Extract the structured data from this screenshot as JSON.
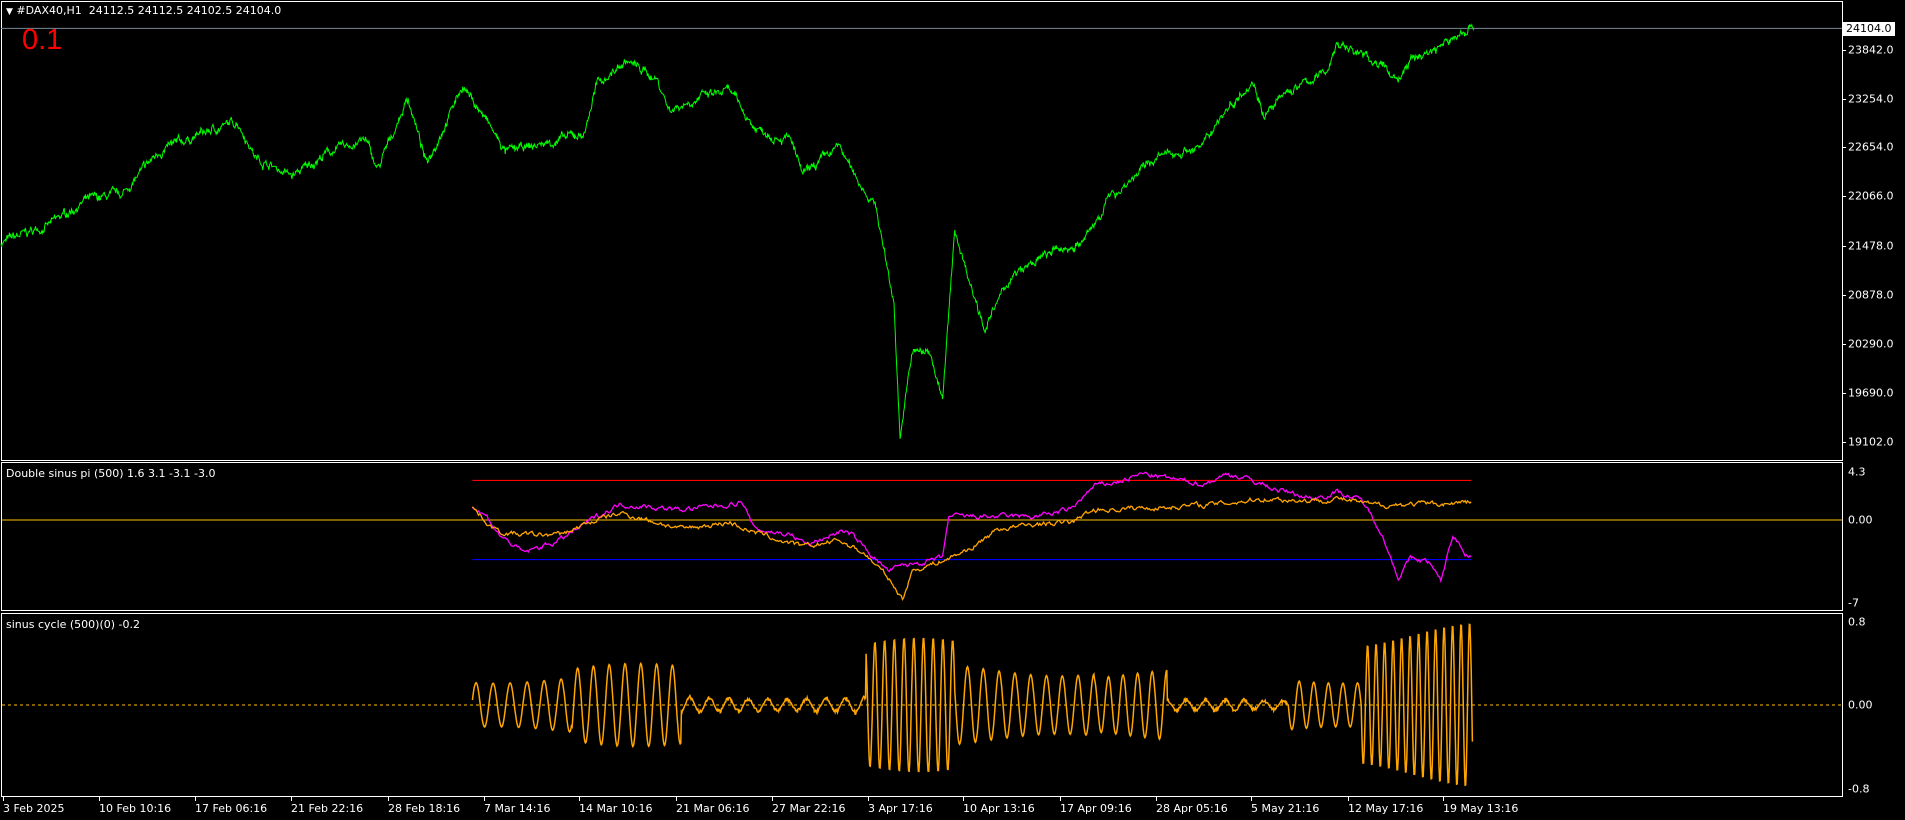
{
  "header": {
    "symbol": "#DAX40,H1",
    "ohlc": "24112.5 24112.5 24102.5 24104.0",
    "overlay_value": "0.1"
  },
  "colors": {
    "price": "#00ff00",
    "magenta": "#ff00ff",
    "orange": "#ffa500",
    "red": "#ff0000",
    "blue": "#0000ff",
    "zero": "#ffc000",
    "bidline": "#778899"
  },
  "price_axis": {
    "current": "24104.0",
    "ticks": [
      "23842.0",
      "23254.0",
      "22654.0",
      "22066.0",
      "21478.0",
      "20878.0",
      "20290.0",
      "19690.0",
      "19102.0"
    ]
  },
  "ind1": {
    "title": "Double sinus pi (500) 1.6 3.1 -3.1 -3.0",
    "ticks": [
      "4.3",
      "0.00",
      "-7"
    ]
  },
  "ind2": {
    "title": "sinus cycle (500)(0) -0.2",
    "ticks": [
      "0.8",
      "0.00",
      "-0.8"
    ]
  },
  "time_axis": [
    "3 Feb 2025",
    "10 Feb 10:16",
    "17 Feb 06:16",
    "21 Feb 22:16",
    "28 Feb 18:16",
    "7 Mar 14:16",
    "14 Mar 10:16",
    "21 Mar 06:16",
    "27 Mar 22:16",
    "3 Apr 17:16",
    "10 Apr 13:16",
    "17 Apr 09:16",
    "28 Apr 05:16",
    "5 May 21:16",
    "12 May 17:16",
    "19 May 13:16"
  ],
  "chart_data": [
    {
      "type": "line",
      "title": "#DAX40,H1",
      "ylim": [
        18950,
        24200
      ],
      "current": 24104.0,
      "series": [
        {
          "name": "price",
          "points": [
            [
              0,
              21510
            ],
            [
              40,
              21730
            ],
            [
              70,
              22023
            ],
            [
              100,
              22096
            ],
            [
              130,
              22610
            ],
            [
              165,
              22830
            ],
            [
              195,
              22976
            ],
            [
              210,
              22536
            ],
            [
              240,
              22316
            ],
            [
              270,
              22610
            ],
            [
              300,
              22756
            ],
            [
              310,
              22390
            ],
            [
              335,
              23270
            ],
            [
              350,
              22463
            ],
            [
              380,
              23417
            ],
            [
              400,
              22976
            ],
            [
              415,
              22610
            ],
            [
              440,
              22683
            ],
            [
              480,
              22830
            ],
            [
              490,
              23417
            ],
            [
              515,
              23710
            ],
            [
              540,
              23490
            ],
            [
              550,
              23123
            ],
            [
              575,
              23270
            ],
            [
              600,
              23343
            ],
            [
              620,
              22903
            ],
            [
              650,
              22756
            ],
            [
              660,
              22316
            ],
            [
              690,
              22683
            ],
            [
              700,
              22390
            ],
            [
              720,
              21950
            ],
            [
              735,
              20776
            ],
            [
              740,
              19162
            ],
            [
              750,
              20189
            ],
            [
              765,
              20189
            ],
            [
              775,
              19603
            ],
            [
              785,
              21656
            ],
            [
              800,
              20923
            ],
            [
              810,
              20483
            ],
            [
              830,
              21070
            ],
            [
              860,
              21363
            ],
            [
              890,
              21510
            ],
            [
              900,
              21730
            ],
            [
              910,
              22023
            ],
            [
              950,
              22536
            ],
            [
              990,
              22683
            ],
            [
              1000,
              22976
            ],
            [
              1030,
              23490
            ],
            [
              1040,
              23050
            ],
            [
              1060,
              23343
            ],
            [
              1090,
              23563
            ],
            [
              1100,
              23930
            ],
            [
              1130,
              23710
            ],
            [
              1150,
              23490
            ],
            [
              1160,
              23710
            ],
            [
              1190,
              23930
            ],
            [
              1212,
              24150
            ]
          ]
        }
      ]
    },
    {
      "type": "line",
      "title": "Double sinus pi (500)",
      "ylim": [
        -7,
        4.3
      ],
      "levels": [
        3.5,
        0,
        -3.5
      ],
      "series": [
        {
          "name": "magenta",
          "points": [
            [
              388,
              1.1
            ],
            [
              400,
              0.3
            ],
            [
              410,
              -1.3
            ],
            [
              430,
              -2.9
            ],
            [
              460,
              -1.8
            ],
            [
              490,
              0.3
            ],
            [
              510,
              1.4
            ],
            [
              540,
              1.1
            ],
            [
              560,
              0.9
            ],
            [
              600,
              1.4
            ],
            [
              610,
              1.6
            ],
            [
              620,
              -0.8
            ],
            [
              650,
              -1.3
            ],
            [
              665,
              -2.2
            ],
            [
              690,
              -1.0
            ],
            [
              700,
              -1.3
            ],
            [
              715,
              -2.9
            ],
            [
              730,
              -4.5
            ],
            [
              745,
              -4.0
            ],
            [
              760,
              -3.7
            ],
            [
              775,
              -3.4
            ],
            [
              780,
              0.3
            ],
            [
              800,
              0.3
            ],
            [
              850,
              0.3
            ],
            [
              880,
              0.9
            ],
            [
              900,
              3.0
            ],
            [
              920,
              3.4
            ],
            [
              940,
              4.1
            ],
            [
              970,
              3.5
            ],
            [
              990,
              3.2
            ],
            [
              1010,
              4.1
            ],
            [
              1030,
              3.5
            ],
            [
              1050,
              2.7
            ],
            [
              1080,
              1.9
            ],
            [
              1100,
              2.5
            ],
            [
              1120,
              1.7
            ],
            [
              1135,
              -0.8
            ],
            [
              1150,
              -5.1
            ],
            [
              1160,
              -3.4
            ],
            [
              1175,
              -3.7
            ],
            [
              1185,
              -5.4
            ],
            [
              1195,
              -1.3
            ],
            [
              1205,
              -2.9
            ],
            [
              1210,
              -3.1
            ]
          ]
        },
        {
          "name": "orange",
          "points": [
            [
              388,
              1.1
            ],
            [
              400,
              -0.2
            ],
            [
              410,
              -1.1
            ],
            [
              430,
              -1.3
            ],
            [
              460,
              -1.3
            ],
            [
              490,
              0
            ],
            [
              510,
              0.6
            ],
            [
              540,
              -0.2
            ],
            [
              560,
              -0.8
            ],
            [
              600,
              -0.2
            ],
            [
              620,
              -1.1
            ],
            [
              660,
              -2.4
            ],
            [
              690,
              -1.8
            ],
            [
              710,
              -2.9
            ],
            [
              730,
              -5.1
            ],
            [
              742,
              -7.0
            ],
            [
              750,
              -4.5
            ],
            [
              780,
              -3.4
            ],
            [
              800,
              -2.4
            ],
            [
              820,
              -0.8
            ],
            [
              850,
              -0.4
            ],
            [
              880,
              -0.2
            ],
            [
              900,
              0.9
            ],
            [
              950,
              1.1
            ],
            [
              1000,
              1.4
            ],
            [
              1040,
              1.9
            ],
            [
              1080,
              1.7
            ],
            [
              1100,
              1.9
            ],
            [
              1130,
              1.3
            ],
            [
              1160,
              1.4
            ],
            [
              1180,
              1.4
            ],
            [
              1210,
              1.6
            ]
          ]
        }
      ]
    },
    {
      "type": "line",
      "title": "sinus cycle (500)(0)",
      "ylim": [
        -0.8,
        0.8
      ],
      "envelope": [
        [
          388,
          0.3,
          14
        ],
        [
          470,
          0.4,
          13
        ],
        [
          560,
          0.08,
          16
        ],
        [
          712,
          0.65,
          8
        ],
        [
          785,
          0.4,
          13
        ],
        [
          900,
          0.35,
          12
        ],
        [
          960,
          0.05,
          16
        ],
        [
          1060,
          0.3,
          12
        ],
        [
          1120,
          0.8,
          7
        ],
        [
          1211,
          0.8,
          7
        ]
      ],
      "last": -0.2
    }
  ]
}
